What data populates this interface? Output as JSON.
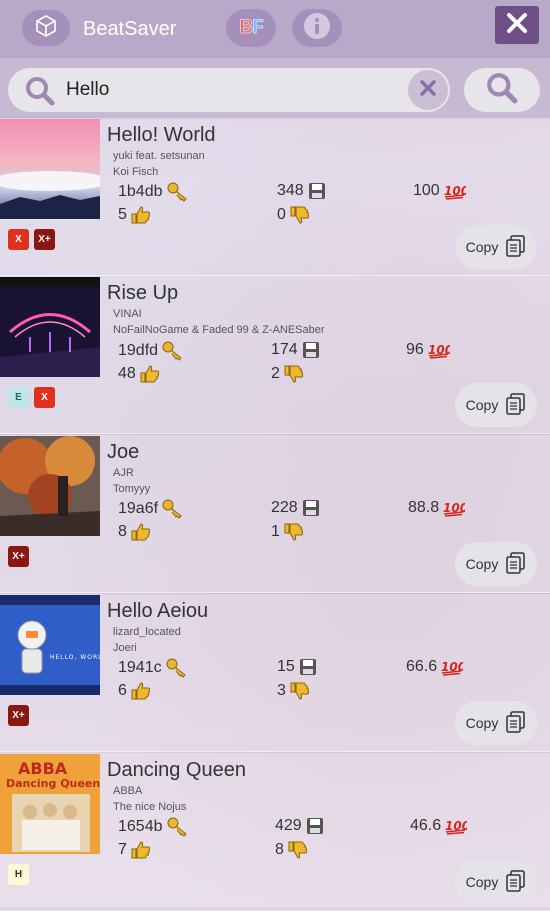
{
  "header": {
    "title": "BeatSaver",
    "bf_b": "B",
    "bf_f": "F"
  },
  "search": {
    "value": "Hello"
  },
  "copy_label": "Copy",
  "maps": [
    {
      "song": "Hello! World",
      "artist": "yuki feat. setsunan",
      "mapper": "Koi Fisch",
      "key": "1b4db",
      "downloads": "348",
      "rating": "100",
      "upvotes": "5",
      "downvotes": "0",
      "difficulties": [
        "X",
        "X+"
      ],
      "cover": "sky"
    },
    {
      "song": "Rise Up",
      "artist": "VINAI",
      "mapper": "NoFailNoGame & Faded 99 & Z-ANESaber",
      "key": "19dfd",
      "downloads": "174",
      "rating": "96",
      "upvotes": "48",
      "downvotes": "2",
      "difficulties": [
        "E",
        "X"
      ],
      "cover": "neon"
    },
    {
      "song": "Joe",
      "artist": "AJR",
      "mapper": "Tomyyy",
      "key": "19a6f",
      "downloads": "228",
      "rating": "88.8",
      "upvotes": "8",
      "downvotes": "1",
      "difficulties": [
        "X+"
      ],
      "cover": "autumn"
    },
    {
      "song": "Hello Aeiou",
      "artist": "lizard_located",
      "mapper": "Joeri",
      "key": "1941c",
      "downloads": "15",
      "rating": "66.6",
      "upvotes": "6",
      "downvotes": "3",
      "difficulties": [
        "X+"
      ],
      "cover": "astronaut"
    },
    {
      "song": "Dancing Queen",
      "artist": "ABBA",
      "mapper": "The nice Nojus",
      "key": "1654b",
      "downloads": "429",
      "rating": "46.6",
      "upvotes": "7",
      "downvotes": "8",
      "difficulties": [
        "H"
      ],
      "cover": "abba"
    }
  ],
  "abba_cover": {
    "band": "ABBA",
    "title": "Dancing Queen"
  }
}
